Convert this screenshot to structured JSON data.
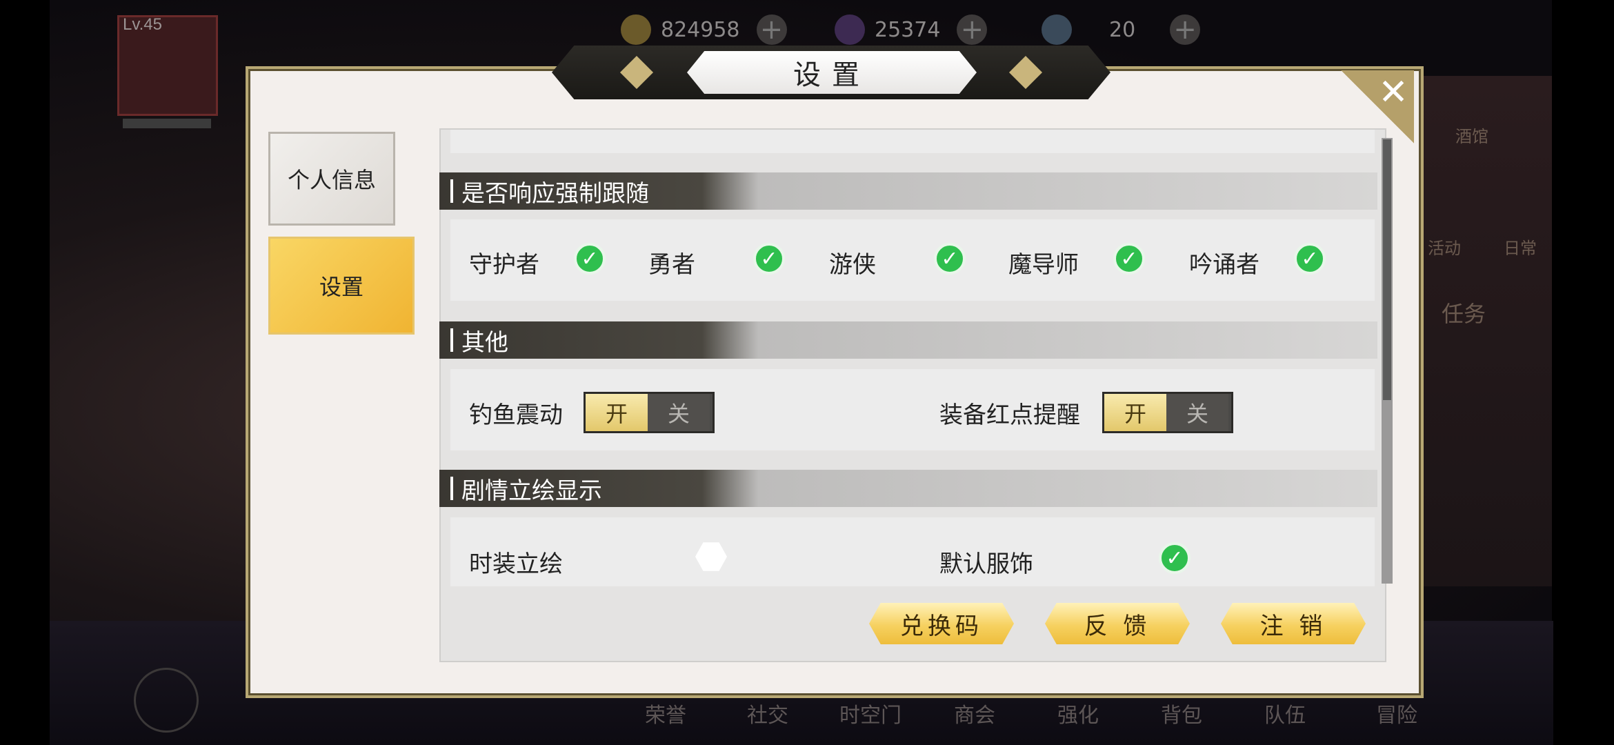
{
  "hud": {
    "level": "Lv.45",
    "gold": "824958",
    "gems": "25374",
    "orbs": "20"
  },
  "bottom_nav": [
    "荣誉",
    "社交",
    "时空门",
    "商会",
    "强化",
    "背包",
    "队伍",
    "冒险"
  ],
  "right_panel": {
    "tavern": "酒馆",
    "activity": "活动",
    "daily": "日常",
    "task": "任务"
  },
  "dialog": {
    "title": "设置",
    "close": "✕",
    "tabs": [
      {
        "label": "个人信息",
        "active": false
      },
      {
        "label": "设置",
        "active": true
      }
    ],
    "sections": {
      "follow": {
        "title": "是否响应强制跟随",
        "options": [
          "守护者",
          "勇者",
          "游侠",
          "魔导师",
          "吟诵者"
        ]
      },
      "other": {
        "title": "其他",
        "fishing_label": "钓鱼震动",
        "equip_label": "装备红点提醒",
        "on": "开",
        "off": "关"
      },
      "portrait": {
        "title": "剧情立绘显示",
        "fashion_label": "时装立绘",
        "default_label": "默认服饰"
      }
    },
    "buttons": {
      "redeem": "兑换码",
      "feedback": "反 馈",
      "logout": "注 销"
    }
  },
  "colors": {
    "check_green": "#2fbf4e",
    "gold_button": "#f6d160",
    "active_tab": "#f0b432",
    "section_header": "#3a3732"
  }
}
